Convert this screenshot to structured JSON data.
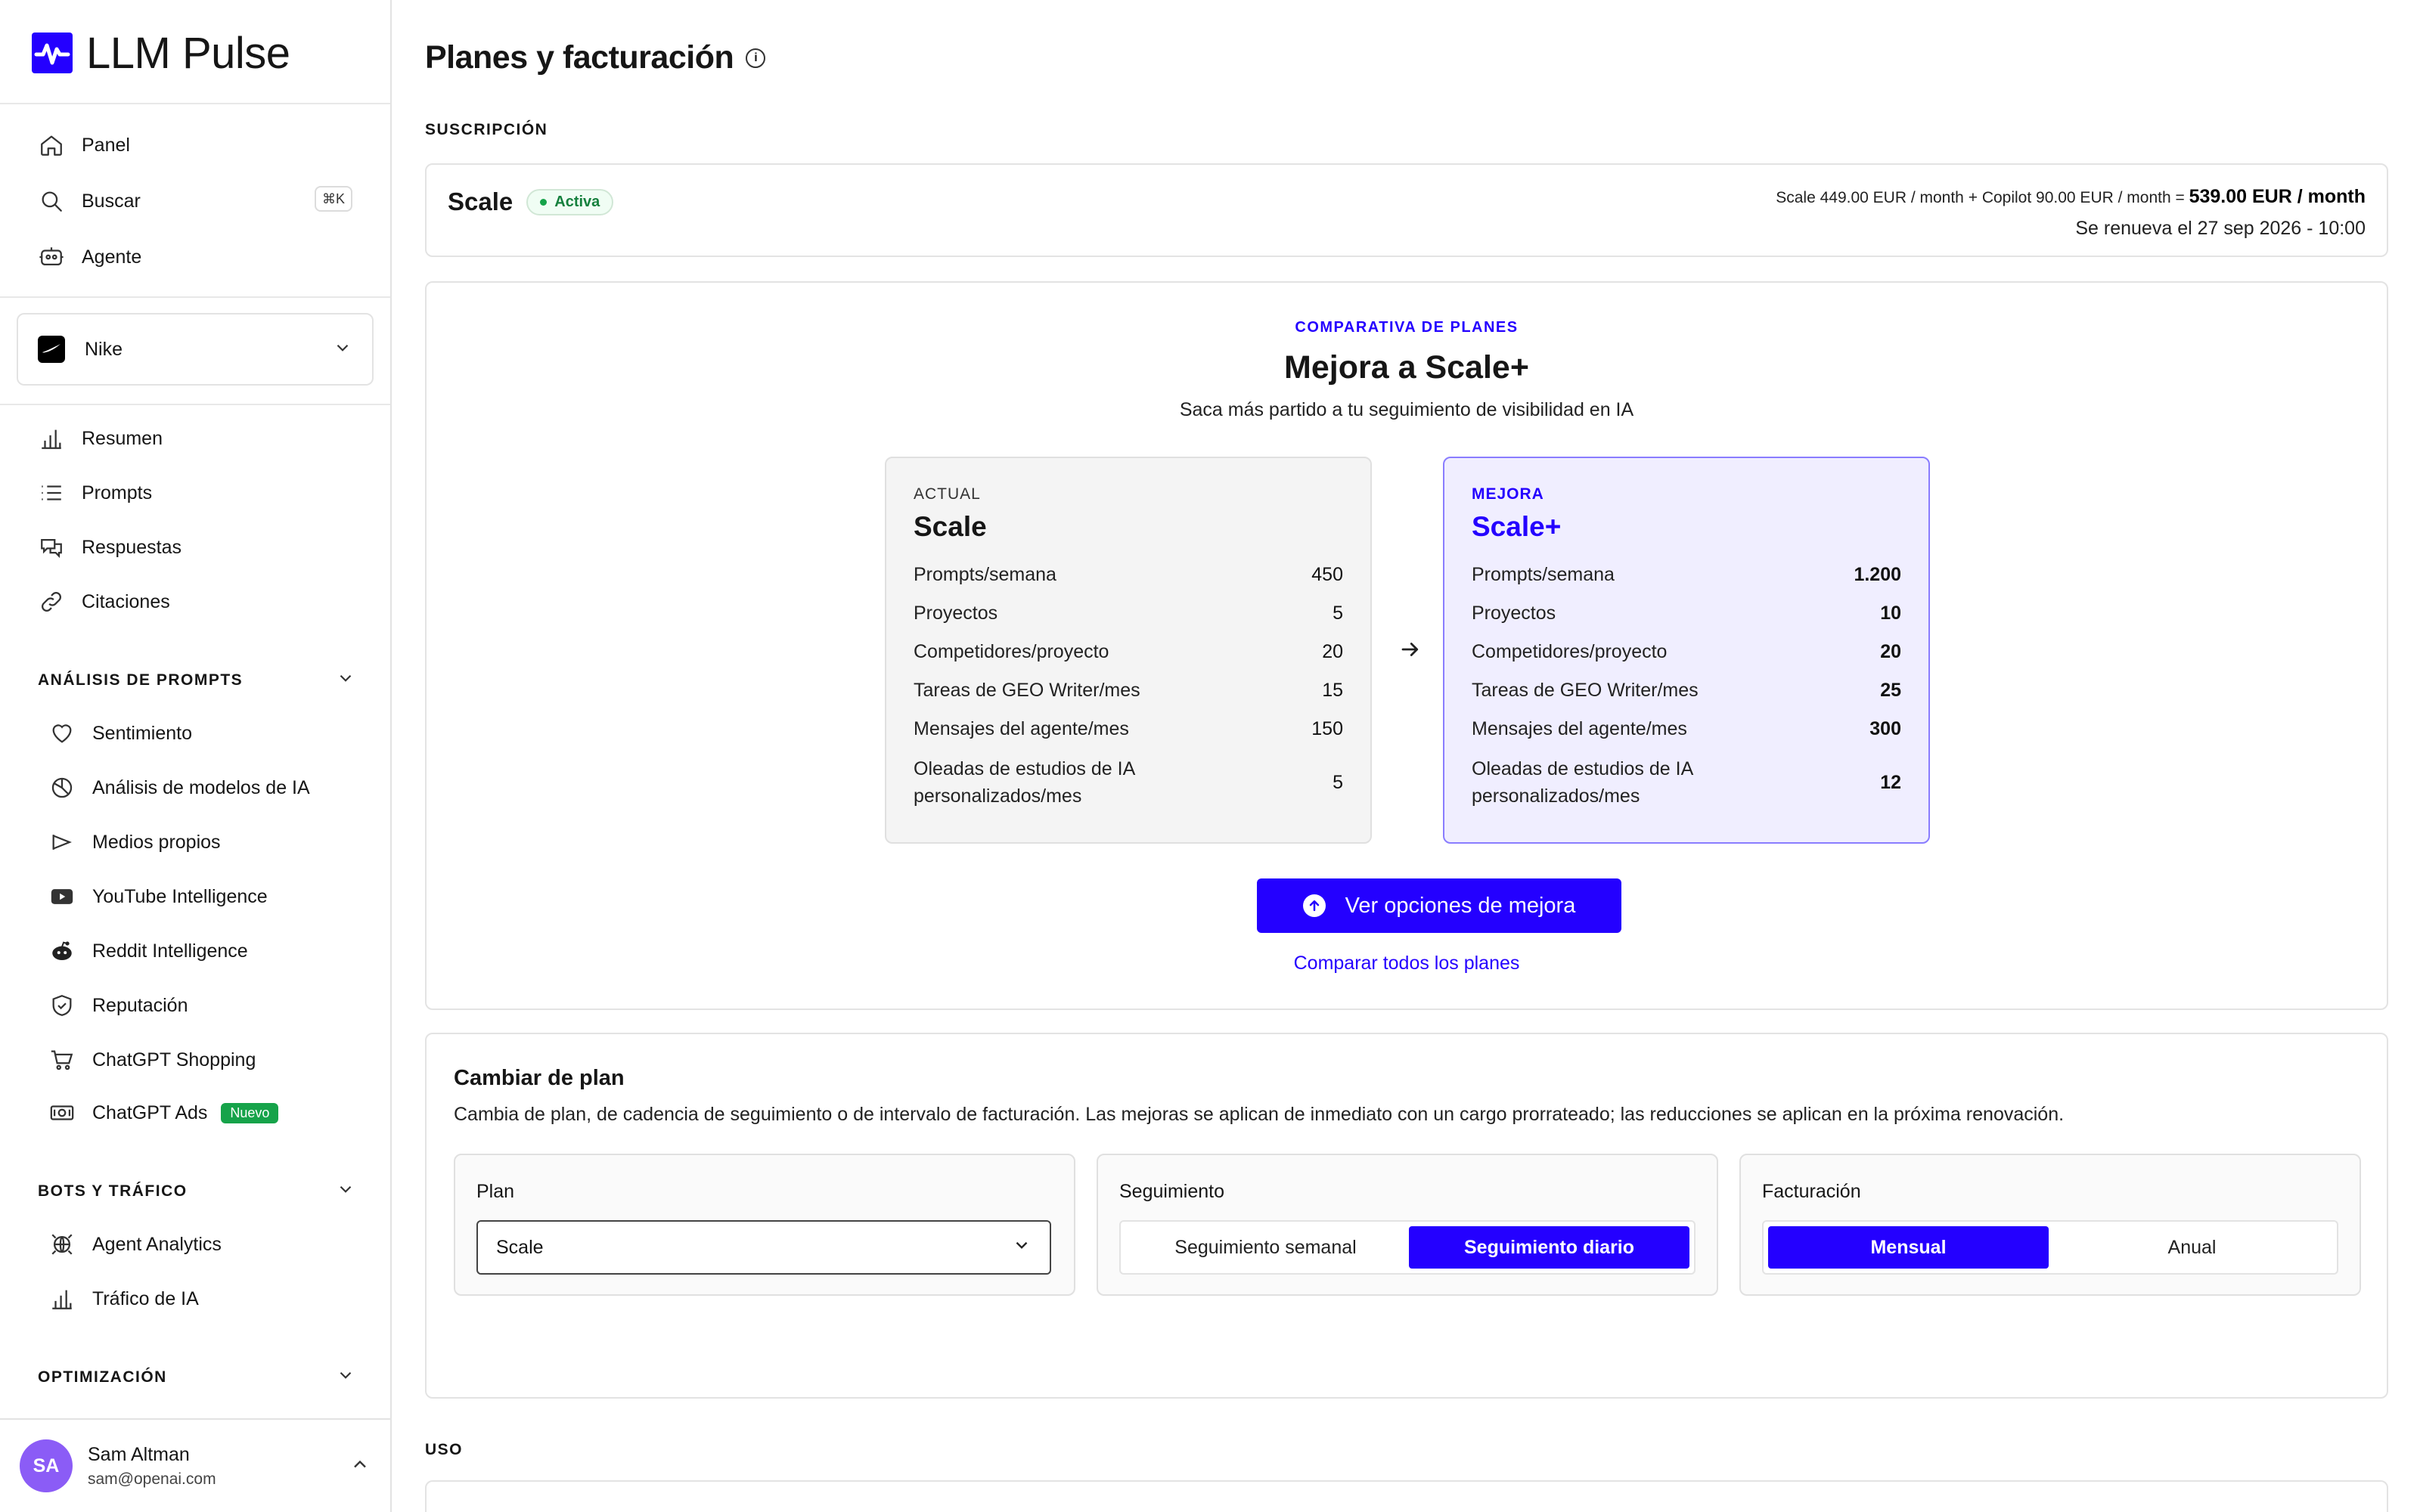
{
  "app": {
    "name": "LLM Pulse"
  },
  "sidebar": {
    "top_items": [
      {
        "label": "Panel",
        "icon": "home-icon"
      },
      {
        "label": "Buscar",
        "icon": "search-icon",
        "shortcut": "⌘K"
      },
      {
        "label": "Agente",
        "icon": "robot-icon"
      }
    ],
    "project": {
      "name": "Nike"
    },
    "main_items": [
      {
        "label": "Resumen",
        "icon": "bar-chart-icon"
      },
      {
        "label": "Prompts",
        "icon": "list-icon"
      },
      {
        "label": "Respuestas",
        "icon": "chat-icon"
      },
      {
        "label": "Citaciones",
        "icon": "link-icon"
      }
    ],
    "sections": [
      {
        "title": "ANÁLISIS DE PROMPTS",
        "items": [
          {
            "label": "Sentimiento",
            "icon": "heart-icon"
          },
          {
            "label": "Análisis de modelos de IA",
            "icon": "pie-chart-icon"
          },
          {
            "label": "Medios propios",
            "icon": "megaphone-icon"
          },
          {
            "label": "YouTube Intelligence",
            "icon": "youtube-icon"
          },
          {
            "label": "Reddit Intelligence",
            "icon": "reddit-icon"
          },
          {
            "label": "Reputación",
            "icon": "shield-icon"
          },
          {
            "label": "ChatGPT Shopping",
            "icon": "cart-icon"
          },
          {
            "label": "ChatGPT Ads",
            "icon": "ad-icon",
            "badge": "Nuevo"
          }
        ]
      },
      {
        "title": "BOTS Y TRÁFICO",
        "items": [
          {
            "label": "Agent Analytics",
            "icon": "bot-globe-icon"
          },
          {
            "label": "Tráfico de IA",
            "icon": "bar-chart-icon"
          }
        ]
      },
      {
        "title": "OPTIMIZACIÓN",
        "items": []
      }
    ],
    "user": {
      "initials": "SA",
      "name": "Sam Altman",
      "email": "sam@openai.com"
    }
  },
  "page": {
    "title": "Planes y facturación",
    "subscription_label": "SUSCRIPCIÓN",
    "subscription": {
      "plan": "Scale",
      "status": "Activa",
      "price_base_label": "Scale",
      "price_base": "449.00 EUR / month",
      "plus": "+",
      "price_addon_label": "Copilot",
      "price_addon": "90.00 EUR / month",
      "equals": "=",
      "price_total": "539.00 EUR / month",
      "renewal": "Se renueva el 27 sep 2026 - 10:00"
    },
    "comparison": {
      "eyebrow": "COMPARATIVA DE PLANES",
      "title": "Mejora a Scale+",
      "subtitle": "Saca más partido a tu seguimiento de visibilidad en IA",
      "current": {
        "tag": "ACTUAL",
        "name": "Scale",
        "features": [
          {
            "label": "Prompts/semana",
            "value": "450"
          },
          {
            "label": "Proyectos",
            "value": "5"
          },
          {
            "label": "Competidores/proyecto",
            "value": "20"
          },
          {
            "label": "Tareas de GEO Writer/mes",
            "value": "15"
          },
          {
            "label": "Mensajes del agente/mes",
            "value": "150"
          },
          {
            "label": "Oleadas de estudios de IA personalizados/mes",
            "value": "5"
          }
        ]
      },
      "upgrade": {
        "tag": "MEJORA",
        "name": "Scale+",
        "features": [
          {
            "label": "Prompts/semana",
            "value": "1.200"
          },
          {
            "label": "Proyectos",
            "value": "10"
          },
          {
            "label": "Competidores/proyecto",
            "value": "20"
          },
          {
            "label": "Tareas de GEO Writer/mes",
            "value": "25"
          },
          {
            "label": "Mensajes del agente/mes",
            "value": "300"
          },
          {
            "label": "Oleadas de estudios de IA personalizados/mes",
            "value": "12"
          }
        ]
      },
      "cta": "Ver opciones de mejora",
      "compare_link": "Comparar todos los planes"
    },
    "change_plan": {
      "title": "Cambiar de plan",
      "description": "Cambia de plan, de cadencia de seguimiento o de intervalo de facturación. Las mejoras se aplican de inmediato con un cargo prorrateado; las reducciones se aplican en la próxima renovación.",
      "plan_label": "Plan",
      "plan_value": "Scale",
      "tracking_label": "Seguimiento",
      "tracking_options": [
        "Seguimiento semanal",
        "Seguimiento diario"
      ],
      "tracking_selected": "Seguimiento diario",
      "billing_label": "Facturación",
      "billing_options": [
        "Mensual",
        "Anual"
      ],
      "billing_selected": "Mensual"
    },
    "usage_label": "USO"
  },
  "colors": {
    "accent": "#2400ff",
    "active_green": "#16a34a",
    "avatar": "#8b5cf6"
  }
}
